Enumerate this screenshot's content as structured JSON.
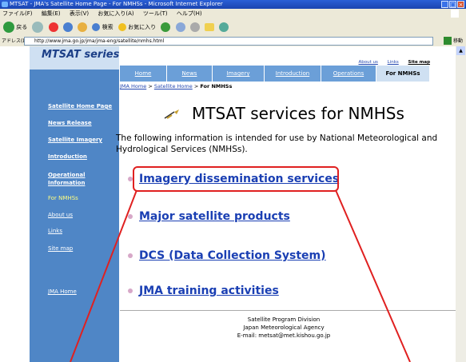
{
  "window": {
    "title": "MTSAT - JMA's Satellite Home Page - For NMHSs - Microsoft Internet Explorer",
    "menu": [
      "ファイル(F)",
      "編集(E)",
      "表示(V)",
      "お気に入り(A)",
      "ツール(T)",
      "ヘルプ(H)"
    ],
    "toolbar": {
      "back": "戻る",
      "search": "検索",
      "favorites": "お気に入り"
    },
    "address_label": "アドレス(D)",
    "address": "http://www.jma.go.jp/jma/jma-eng/satellite/nmhs.html",
    "go_label": "移動"
  },
  "header": {
    "logo": "MTSAT series",
    "toplinks": [
      "About us",
      "Links",
      "Site map"
    ],
    "tabs": [
      "Home",
      "News",
      "Imagery",
      "Introduction",
      "Operations",
      "For NMHSs"
    ]
  },
  "sidebar": {
    "items": [
      "Satellite Home Page",
      "News Release",
      "Satellite Imagery",
      "Introduction",
      "Operational Information",
      "For NMHSs",
      "About us",
      "Links",
      "Site map",
      "JMA Home"
    ]
  },
  "breadcrumb": {
    "items": [
      "JMA Home",
      "Satellite Home",
      "For NMHSs"
    ],
    "sep": ">"
  },
  "main": {
    "title": "MTSAT services for NMHSs",
    "intro": "The following information is intended for use by National Meteorological and Hydrological Services (NMHSs).",
    "services": [
      "Imagery dissemination services",
      "Major satellite products",
      "DCS (Data Collection System)",
      "JMA training activities"
    ]
  },
  "footer": {
    "lines": [
      "Satellite Program Division",
      "Japan Meteorological Agency",
      "E-mail: metsat@met.kishou.go.jp"
    ]
  }
}
